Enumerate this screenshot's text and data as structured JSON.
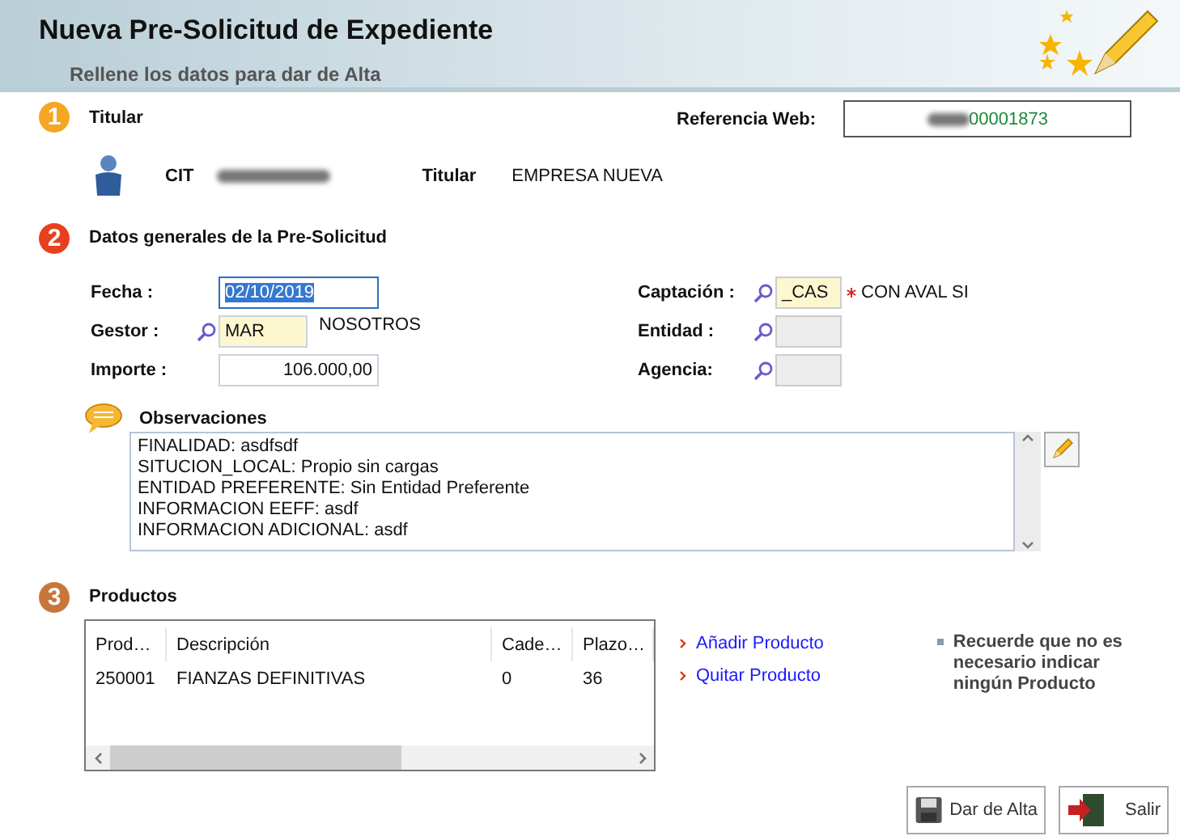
{
  "header": {
    "title": "Nueva Pre-Solicitud de Expediente",
    "subtitle": "Rellene los datos para dar de Alta"
  },
  "sections": [
    {
      "number": "1",
      "title": "Titular",
      "color": "#f5a623"
    },
    {
      "number": "2",
      "title": "Datos generales de la Pre-Solicitud",
      "color": "#e8401c"
    },
    {
      "number": "3",
      "title": "Productos",
      "color": "#c8763a"
    }
  ],
  "titular": {
    "reference_label": "Referencia Web:",
    "reference_value": "00001873",
    "cit_label": "CIT",
    "holder_label": "Titular",
    "holder_value": "EMPRESA NUEVA"
  },
  "general": {
    "left": [
      {
        "label": "Fecha :",
        "value": "02/10/2019",
        "kind": "date",
        "lookup": false,
        "selected": true
      },
      {
        "label": "Gestor :",
        "value": "MAR",
        "kind": "code",
        "lookup": true,
        "selected": false,
        "note": "NOSOTROS"
      },
      {
        "label": "Importe :",
        "value": "106.000,00",
        "kind": "amount",
        "lookup": false,
        "selected": false
      }
    ],
    "right": [
      {
        "label": "Captación :",
        "value": "_CAS",
        "required": true,
        "note": "CON AVAL SI",
        "disabled": false
      },
      {
        "label": "Entidad :",
        "disabled": true,
        "required": false
      },
      {
        "label": "Agencia:",
        "disabled": true,
        "required": false
      }
    ]
  },
  "observations": {
    "label": "Observaciones",
    "lines": [
      "FINALIDAD: asdfsdf",
      "SITUCION_LOCAL: Propio sin cargas",
      "ENTIDAD PREFERENTE: Sin Entidad Preferente",
      "INFORMACION EEFF: asdf",
      "INFORMACION ADICIONAL: asdf"
    ]
  },
  "products": {
    "columns": [
      "Prod…",
      "Descripción",
      "Cade…",
      "Plazo…"
    ],
    "rows": [
      [
        "250001",
        "FIANZAS DEFINITIVAS",
        "0",
        "36"
      ]
    ],
    "links": [
      "Añadir Producto",
      "Quitar Producto"
    ],
    "note": "Recuerde que no es necesario indicar ningún Producto"
  },
  "buttons": [
    {
      "label": "Dar de Alta",
      "kind": "save"
    },
    {
      "label": "Salir",
      "kind": "exit"
    }
  ]
}
